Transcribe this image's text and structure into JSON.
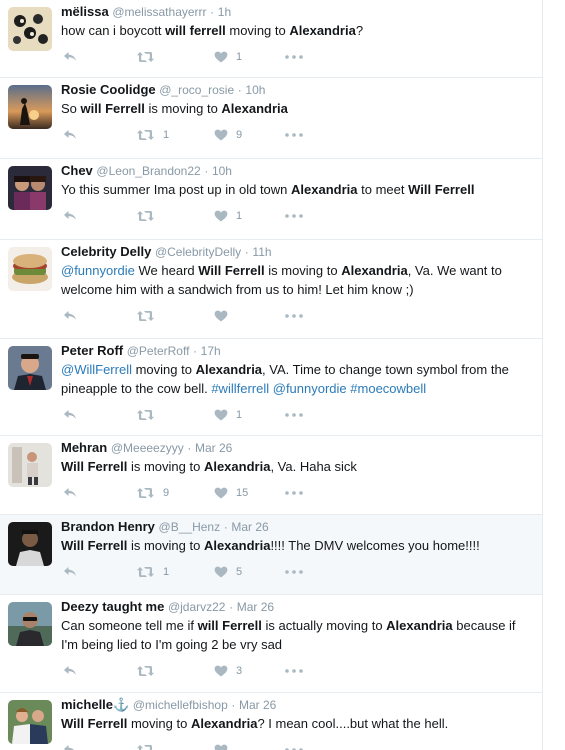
{
  "tweets": [
    {
      "name": "mëlissa",
      "handle": "@melissathayerrr",
      "sep": "·",
      "time": "1h",
      "segments": [
        {
          "t": "how can i boycott "
        },
        {
          "t": "will ferrell",
          "s": "b"
        },
        {
          "t": " moving to "
        },
        {
          "t": "Alexandria",
          "s": "b"
        },
        {
          "t": "?"
        }
      ],
      "retweets": "",
      "likes": "1"
    },
    {
      "name": "Rosie Coolidge",
      "handle": "@_roco_rosie",
      "sep": "·",
      "time": "10h",
      "segments": [
        {
          "t": "So "
        },
        {
          "t": "will Ferrell",
          "s": "b"
        },
        {
          "t": " is moving to "
        },
        {
          "t": "Alexandria",
          "s": "b"
        }
      ],
      "retweets": "1",
      "likes": "9"
    },
    {
      "name": "Chev",
      "handle": "@Leon_Brandon22",
      "sep": "·",
      "time": "10h",
      "segments": [
        {
          "t": "Yo this summer Ima post up in old town "
        },
        {
          "t": "Alexandria",
          "s": "b"
        },
        {
          "t": " to meet "
        },
        {
          "t": "Will Ferrell",
          "s": "b"
        }
      ],
      "retweets": "",
      "likes": "1"
    },
    {
      "name": "Celebrity Delly",
      "handle": "@CelebrityDelly",
      "sep": "·",
      "time": "11h",
      "segments": [
        {
          "t": "@funnyordie",
          "s": "l"
        },
        {
          "t": " We heard "
        },
        {
          "t": "Will Ferrell",
          "s": "b"
        },
        {
          "t": " is moving to "
        },
        {
          "t": "Alexandria",
          "s": "b"
        },
        {
          "t": ", Va. We want to\nwelcome him with a sandwich from us to him! Let him know ;)"
        }
      ],
      "retweets": "",
      "likes": ""
    },
    {
      "name": "Peter Roff",
      "handle": "@PeterRoff",
      "sep": "·",
      "time": "17h",
      "segments": [
        {
          "t": "@WillFerrell",
          "s": "l"
        },
        {
          "t": " moving to "
        },
        {
          "t": "Alexandria",
          "s": "b"
        },
        {
          "t": ", VA. Time to change town symbol from the\npineapple to the cow bell. "
        },
        {
          "t": "#willferrell",
          "s": "l"
        },
        {
          "t": " "
        },
        {
          "t": "@funnyordie",
          "s": "l"
        },
        {
          "t": " "
        },
        {
          "t": "#moecowbell",
          "s": "l"
        }
      ],
      "retweets": "",
      "likes": "1"
    },
    {
      "name": "Mehran",
      "handle": "@Meeeezyyy",
      "sep": "·",
      "time": "Mar 26",
      "segments": [
        {
          "t": "Will Ferrell",
          "s": "b"
        },
        {
          "t": " is moving to "
        },
        {
          "t": "Alexandria",
          "s": "b"
        },
        {
          "t": ", Va. Haha sick"
        }
      ],
      "retweets": "9",
      "likes": "15"
    },
    {
      "name": "Brandon Henry",
      "handle": "@B__Henz",
      "sep": "·",
      "time": "Mar 26",
      "segments": [
        {
          "t": "Will Ferrell",
          "s": "b"
        },
        {
          "t": " is moving to "
        },
        {
          "t": "Alexandria",
          "s": "b"
        },
        {
          "t": "!!!! The DMV welcomes you home!!!!"
        }
      ],
      "retweets": "1",
      "likes": "5"
    },
    {
      "name": "Deezy taught me",
      "handle": "@jdarvz22",
      "sep": "·",
      "time": "Mar 26",
      "segments": [
        {
          "t": "Can someone tell me if "
        },
        {
          "t": "will Ferrell",
          "s": "b"
        },
        {
          "t": " is actually moving to "
        },
        {
          "t": "Alexandria",
          "s": "b"
        },
        {
          "t": " because if\nI'm being lied to I'm going 2 be vry sad"
        }
      ],
      "retweets": "",
      "likes": "3"
    },
    {
      "name": "michelle",
      "name_suffix": "⚓",
      "handle": "@michellefbishop",
      "sep": "·",
      "time": "Mar 26",
      "segments": [
        {
          "t": "Will Ferrell",
          "s": "b"
        },
        {
          "t": " moving to "
        },
        {
          "t": "Alexandria",
          "s": "b"
        },
        {
          "t": "? I mean cool....but what the hell."
        }
      ],
      "retweets": "",
      "likes": ""
    }
  ],
  "icons": {
    "reply": "reply-icon",
    "retweet": "retweet-icon",
    "like": "heart-icon",
    "more": "more-dots-icon"
  },
  "colors": {
    "link": "#2b7bb9",
    "meta": "#8899a6",
    "icon": "#aab8c2",
    "highlight_bg": "#f5f8fa",
    "divider": "#e6ecf0"
  }
}
